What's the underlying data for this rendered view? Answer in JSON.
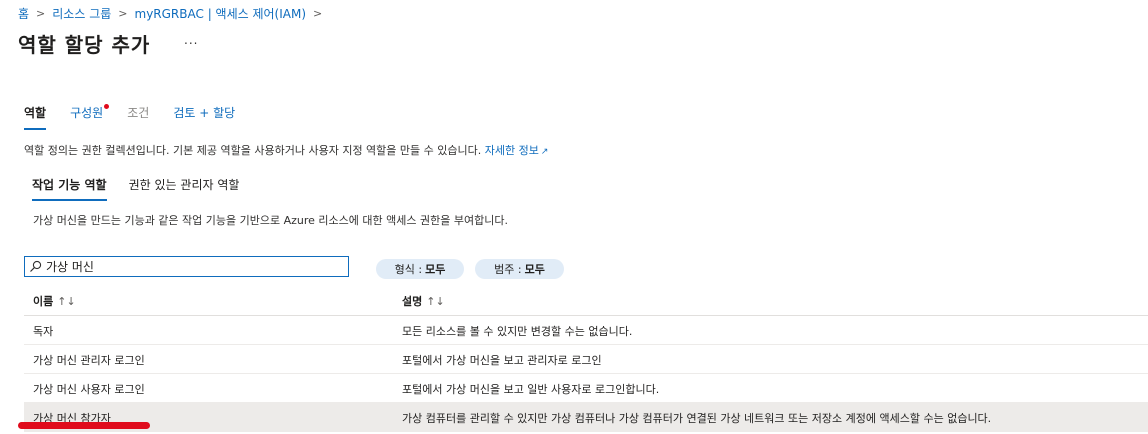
{
  "breadcrumb": [
    "홈",
    "리소스 그룹",
    "myRGRBAC | 액세스 제어(IAM)"
  ],
  "page": {
    "title": "역할 할당 추가",
    "more": "..."
  },
  "tabs": [
    "역할",
    "구성원",
    "조건",
    "검토 + 할당"
  ],
  "description": {
    "text": "역할 정의는 권한 컬렉션입니다. 기본 제공 역할을 사용하거나 사용자 지정 역할을 만들 수 있습니다.",
    "link": "자세한 정보"
  },
  "subtabs": [
    "작업 기능 역할",
    "권한 있는 관리자 역할"
  ],
  "subdescription": "가상 머신을 만드는 기능과 같은 작업 기능을 기반으로 Azure 리소스에 대한 액세스 권한을 부여합니다.",
  "search": {
    "value": "가상 머신"
  },
  "filters": [
    {
      "label": "형식 :",
      "value": "모두"
    },
    {
      "label": "범주 :",
      "value": "모두"
    }
  ],
  "table": {
    "columns": [
      "이름",
      "설명"
    ],
    "sort_icon": "↑↓",
    "rows": [
      {
        "name": "독자",
        "description": "모든 리소스를 볼 수 있지만 변경할 수는 없습니다."
      },
      {
        "name": "가상 머신 관리자 로그인",
        "description": "포털에서 가상 머신을 보고 관리자로 로그인"
      },
      {
        "name": "가상 머신 사용자 로그인",
        "description": "포털에서 가상 머신을 보고 일반 사용자로 로그인합니다."
      },
      {
        "name": "가상 머신 참가자",
        "description": "가상 컴퓨터를 관리할 수 있지만 가상 컴퓨터나 가상 컴퓨터가 연결된 가상 네트워크 또는 저장소 계정에 액세스할 수는 없습니다."
      }
    ]
  },
  "colors": {
    "accent": "#0f6cbd",
    "annotation": "#e00b1c",
    "pill_bg": "#e1ecf7"
  },
  "icons": [
    "chevron-right-icon",
    "search-icon",
    "external-link-icon",
    "sort-icon"
  ]
}
